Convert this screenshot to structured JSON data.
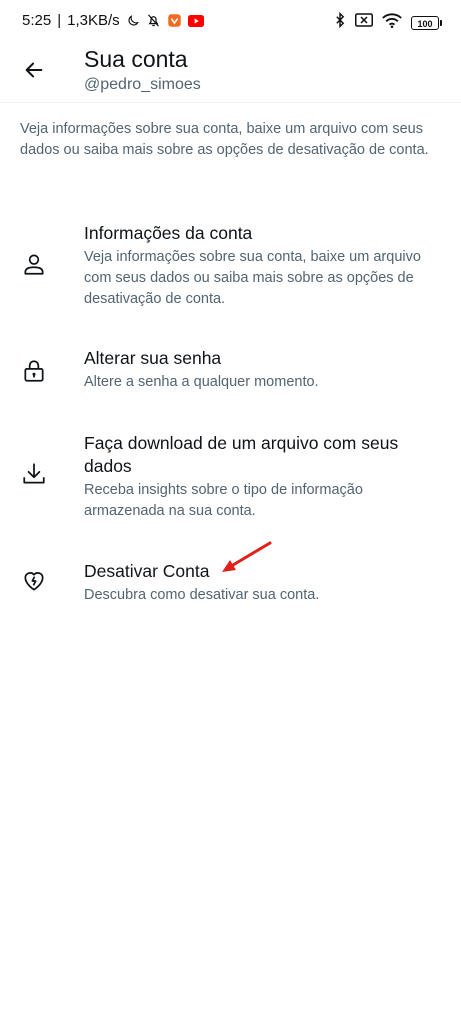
{
  "status_bar": {
    "time": "5:25",
    "net_speed": "1,3KB/s",
    "battery": "100"
  },
  "header": {
    "back_icon": "arrow-left-icon",
    "title": "Sua conta",
    "subtitle": "@pedro_simoes"
  },
  "intro": "Veja informações sobre sua conta, baixe um arquivo com seus dados ou saiba mais sobre as opções de desativação de conta.",
  "items": [
    {
      "icon": "person-icon",
      "title": "Informações da conta",
      "desc": "Veja informações sobre sua conta, baixe um arquivo com seus dados ou saiba mais sobre as opções de desativação de conta."
    },
    {
      "icon": "lock-icon",
      "title": "Alterar sua senha",
      "desc": "Altere a senha a qualquer momento."
    },
    {
      "icon": "download-icon",
      "title": "Faça download de um arquivo com seus dados",
      "desc": "Receba insights sobre o tipo de informação armazenada na sua conta."
    },
    {
      "icon": "broken-heart-icon",
      "title": "Desativar Conta",
      "desc": "Descubra como desativar sua conta."
    }
  ],
  "colors": {
    "primary_text": "#0f1419",
    "secondary_text": "#536471",
    "annotation_arrow": "#e0201b"
  }
}
